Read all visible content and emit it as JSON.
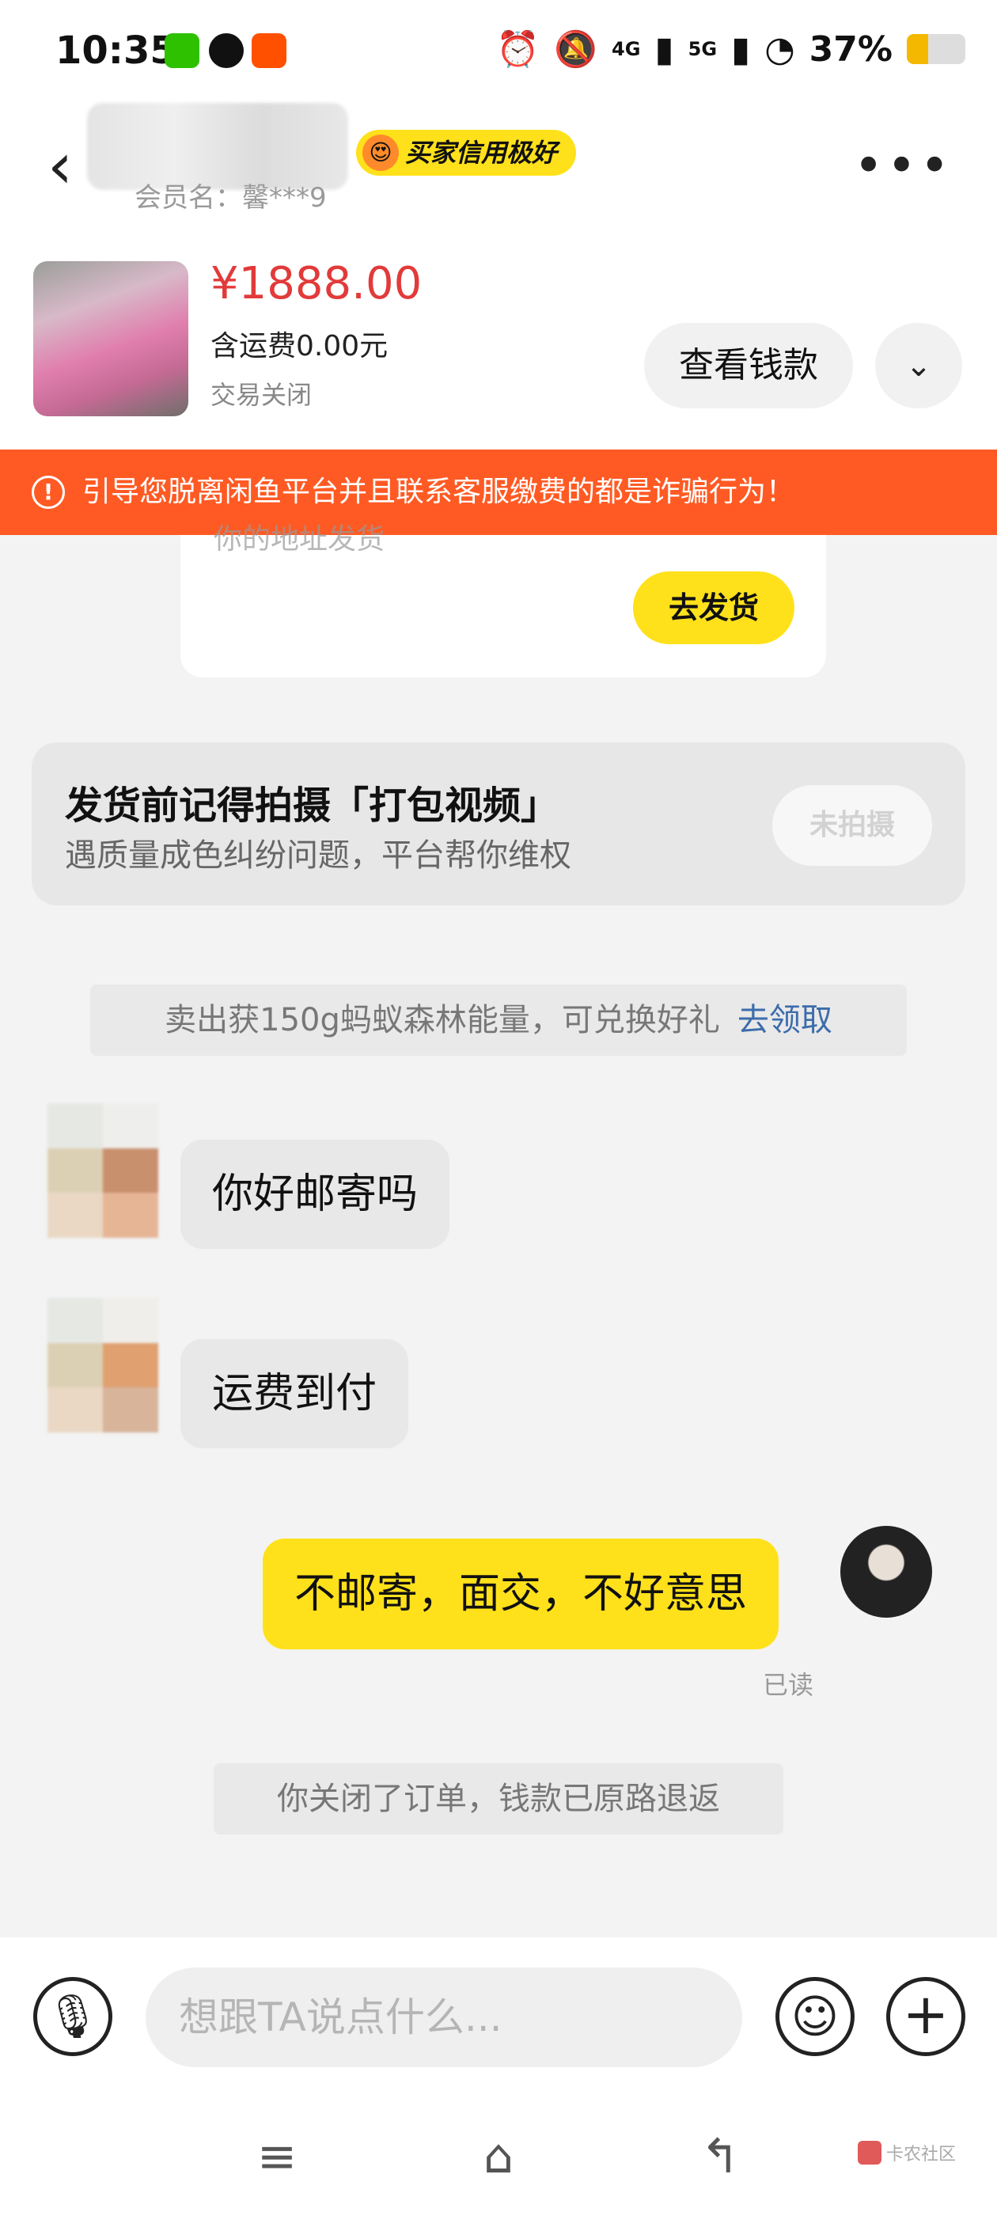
{
  "status_bar": {
    "time": "10:35",
    "signal_1": "4G",
    "signal_2": "5G",
    "battery_text": "37%",
    "battery_level": 0.37,
    "app_icons": [
      "wechat-icon",
      "qq-icon",
      "taobao-icon"
    ]
  },
  "header": {
    "member_label": "会员名：馨***9",
    "credit_badge": "买家信用极好"
  },
  "product": {
    "price": "¥1888.00",
    "shipping_fee": "含运费0.00元",
    "order_status": "交易关闭",
    "view_money_label": "查看钱款"
  },
  "warning": {
    "text": "引导您脱离闲鱼平台并且联系客服缴费的都是诈骗行为！"
  },
  "ship_card": {
    "partial_text": "你的地址发货",
    "go_ship_label": "去发货"
  },
  "video_card": {
    "title": "发货前记得拍摄「打包视频」",
    "subtitle": "遇质量成色纠纷问题，平台帮你维权",
    "button_label": "未拍摄"
  },
  "notices": {
    "reward_text": "卖出获150g蚂蚁森林能量，可兑换好礼",
    "reward_link": "去领取",
    "closed_text": "你关闭了订单，钱款已原路退返"
  },
  "messages": [
    {
      "from": "buyer",
      "text": "你好邮寄吗"
    },
    {
      "from": "buyer",
      "text": "运费到付"
    },
    {
      "from": "me",
      "text": "不邮寄，面交，不好意思",
      "read_status": "已读"
    }
  ],
  "input": {
    "placeholder": "想跟TA说点什么..."
  },
  "watermark": {
    "text": "卡农社区"
  },
  "colors": {
    "accent_yellow": "#ffe11b",
    "price_red": "#e23a3a",
    "warning_orange": "#ff5a23",
    "link_blue": "#3c6cab"
  }
}
